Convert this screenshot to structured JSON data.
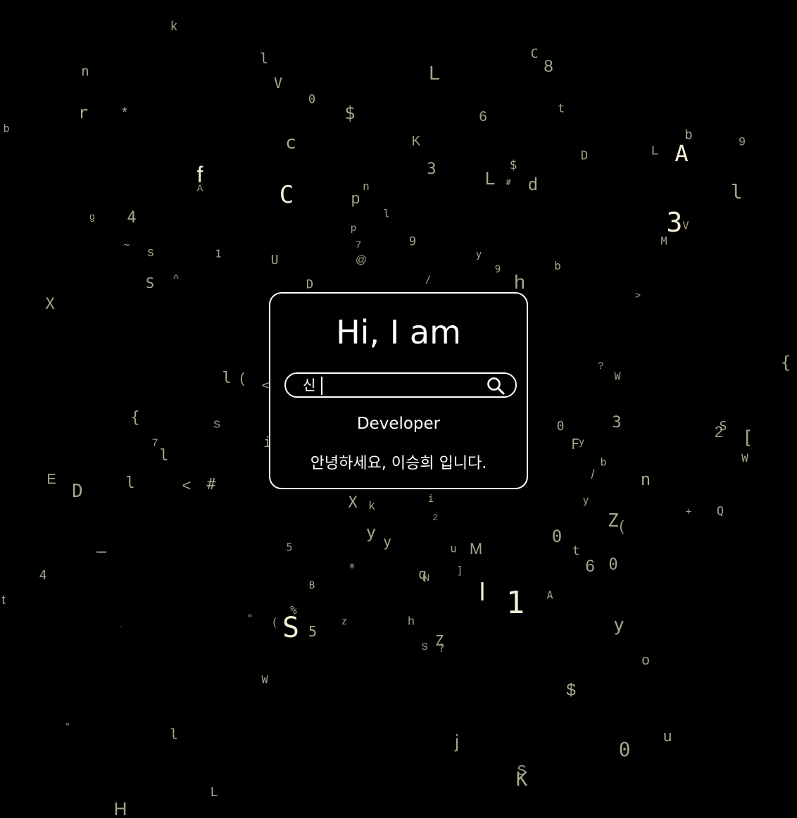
{
  "card": {
    "greeting": "Hi, I am",
    "search": {
      "value": "신",
      "placeholder": "",
      "button_icon": "search-icon"
    },
    "role": "Developer",
    "introduction": "안녕하세요, 이승희 입니다."
  },
  "background": {
    "color": "#000000",
    "glyph_color": "#a8a48a",
    "highlight_color": "#f4f0d6",
    "glyphs": [
      "k",
      "l",
      "C",
      "8",
      "n",
      "V",
      "L",
      "0",
      "$",
      "6",
      "t",
      "r",
      "*",
      "b",
      "c",
      "K",
      "b",
      "A",
      "9",
      "D",
      "L",
      "f",
      "$",
      "3",
      "L",
      "d",
      "l",
      "A",
      "#",
      "C",
      "p",
      "n",
      "3",
      "g",
      "4",
      "l",
      "p",
      "V",
      "M",
      "7",
      "9",
      "~",
      "s",
      "1",
      "U",
      "@",
      "y",
      "9",
      "h",
      "b",
      "S",
      "^",
      "D",
      "/",
      ">",
      "X",
      "{",
      "?",
      "W",
      "l",
      "(",
      "<",
      "{",
      "S",
      "0",
      "3",
      "2",
      "S",
      "[",
      "7",
      "i",
      "F",
      "y",
      "l",
      "b",
      "/",
      "n",
      "W",
      "E",
      "D",
      "l",
      "<",
      "#",
      "X",
      "k",
      "i",
      "y",
      "+",
      "Q",
      "y",
      "2",
      "y",
      "Z",
      "(",
      "5",
      "u",
      "M",
      "0",
      "t",
      "6",
      "0",
      "4",
      "_",
      "*",
      "q",
      "N",
      "]",
      "B",
      "l",
      "1",
      "A",
      "t",
      "%",
      "\"",
      "(",
      "5",
      "z",
      "h",
      "S",
      "y",
      "S",
      "Z",
      "?",
      "o",
      ".",
      "W",
      "$",
      "\"",
      "l",
      "j",
      "u",
      "0",
      "S",
      "K",
      "L",
      "H"
    ]
  }
}
